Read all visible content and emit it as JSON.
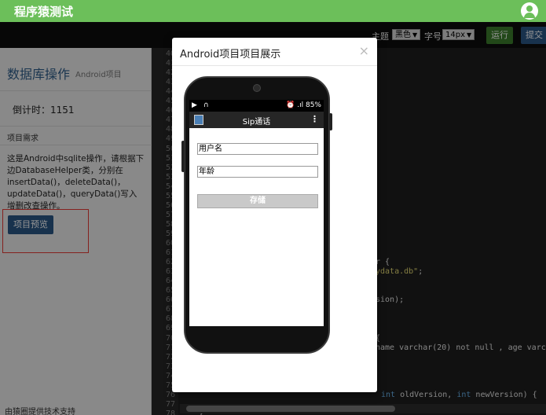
{
  "app": {
    "title": "程序猿测试"
  },
  "toolbar": {
    "theme_label": "主题",
    "theme_value": "黑色",
    "font_label": "字号",
    "font_value": "14px",
    "run_label": "运行",
    "submit_label": "提交"
  },
  "left_panel": {
    "title": "数据库操作",
    "subtitle": "Android项目",
    "timer": "倒计时：1151",
    "requirement_heading": "项目需求",
    "requirement_text": "这是Android中sqlite操作，请根据下边DatabaseHelper类，分别在insertData()，deleteData()，updateData()，queryData()写入增删改查操作。",
    "preview_button": "项目预览",
    "footer": "由猿圈提供技术支持"
  },
  "editor": {
    "line_numbers": [
      "40",
      "41",
      "42",
      "43",
      "44",
      "45",
      "46",
      "47",
      "48",
      "49",
      "50",
      "51",
      "52",
      "53",
      "54",
      "55",
      "56",
      "57",
      "58",
      "59",
      "60",
      "61",
      "62",
      "63",
      "64",
      "65",
      "66",
      "67",
      "68",
      "69",
      "70",
      "71",
      "72",
      "73",
      "74",
      "75",
      "76",
      "77",
      "78"
    ],
    "code_fragments": [
      {
        "line": 62,
        "text": "r {"
      },
      {
        "line": 63,
        "text": "ydata.db\";"
      },
      {
        "line": 66,
        "text": "sion);"
      },
      {
        "line": 70,
        "text": "{"
      },
      {
        "line": 71,
        "text": "name varchar(20) not null , age varchar"
      },
      {
        "line": 76,
        "kw": "int",
        "text": " oldVersion, ",
        "kw2": "int",
        "text2": " newVersion) {"
      },
      {
        "line": 78,
        "text": "}"
      }
    ]
  },
  "modal": {
    "title": "Android项目项目展示",
    "close": "×"
  },
  "phone": {
    "status_right": "85%",
    "app_title": "Sip通话",
    "menu_icon": "⋮",
    "name_field": "用户名",
    "age_field": "年龄",
    "save_button": "存储"
  },
  "colors": {
    "header_green": "#6cbf5a",
    "primary_blue": "#2a5686",
    "run_green": "#3c7d2c",
    "highlight_red": "#e53935"
  }
}
